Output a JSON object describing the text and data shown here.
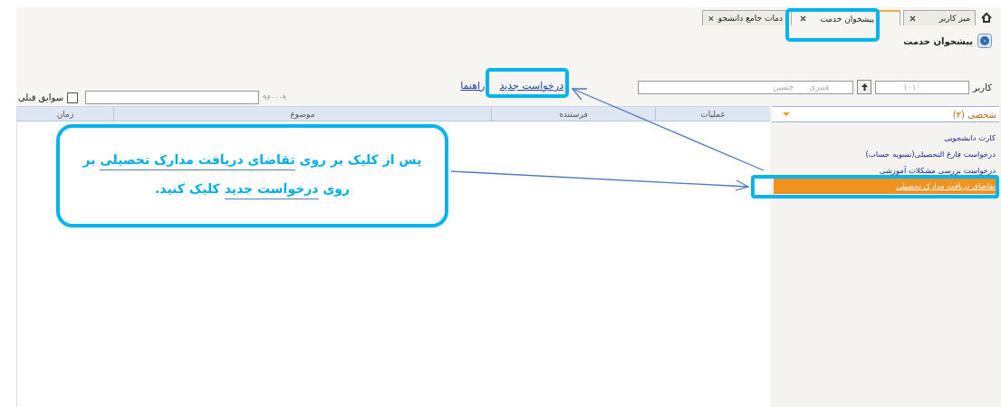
{
  "tabs": [
    {
      "label": "میز کاربر",
      "selected": false
    },
    {
      "label": "پیشخوان خدمت",
      "selected": true
    },
    {
      "label": "دمات جامع دانشجو",
      "selected": false
    }
  ],
  "page_title": "پیشخوان خدمت",
  "filter": {
    "user_label": "کاربر",
    "user_code": "۱۰۱۰",
    "last_name": "قنبری",
    "first_name": "حسین"
  },
  "links": [
    "درخواست جدید",
    "راهنما"
  ],
  "search": {
    "label": "۹۶۰۰۰۹"
  },
  "history": {
    "label": "سوابق قبلی",
    "checked": false
  },
  "sidebar": {
    "title": "شخصی (۲)",
    "items": [
      {
        "label": "کارت دانشجویی",
        "selected": false
      },
      {
        "label": "درخواست فارغ التحصیلی(تسویه حساب)",
        "selected": false
      },
      {
        "label": "درخواست بررسی مشکلات آموزشی",
        "selected": false
      },
      {
        "label": "تقاضای دریافت مدارک تحصیلی",
        "selected": true
      }
    ]
  },
  "table": {
    "columns": [
      "عملیات",
      "فرستنده",
      "موضوع",
      "زمان"
    ]
  },
  "callout": {
    "lines": [
      [
        {
          "text": "پس از کلیک بر روی ",
          "underline": false
        },
        {
          "text": "تقاضای دریافت مدارک تحصیلی",
          "underline": true
        },
        {
          "text": " بر",
          "underline": false
        }
      ],
      [
        {
          "text": "روی ",
          "underline": false
        },
        {
          "text": "درخواست جدید",
          "underline": true
        },
        {
          "text": " کلیک کنید.",
          "underline": false
        }
      ]
    ]
  }
}
